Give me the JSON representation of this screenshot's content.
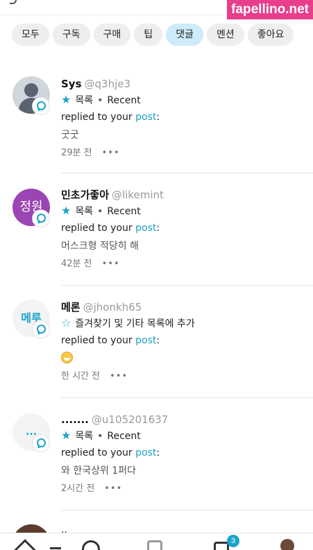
{
  "watermark": "fapellino.net",
  "chips": [
    "모두",
    "구독",
    "구매",
    "팁",
    "댓글",
    "멘션",
    "좋아요"
  ],
  "active_chip": "댓글",
  "notifications": [
    {
      "name": "Sys",
      "handle": "@q3hje3",
      "list": "목록",
      "dot": "•",
      "tag": "Recent",
      "action_text": "replied to your",
      "action_link": "post",
      "action_end": ":",
      "comment": "굿굿",
      "time": "29분 전",
      "more": "•••",
      "avatar_type": "default-avatar"
    },
    {
      "name": "민초가좋아",
      "handle": "@likemint",
      "list": "목록",
      "dot": "•",
      "tag": "Recent",
      "action_text": "replied to your",
      "action_link": "post",
      "action_end": ":",
      "comment": "머스크형 적당히 해",
      "time": "42분 전",
      "more": "•••",
      "avatar_text": "정원"
    },
    {
      "name": "메론",
      "handle": "@jhonkh65",
      "list": "즐겨찾기 및 기타 목록에 추가",
      "action_text": "replied to your",
      "action_link": "post",
      "action_end": ":",
      "comment_emoji": "grinning-emoji",
      "time": "한 시간 전",
      "more": "•••",
      "avatar_text": "메루"
    },
    {
      "name": ".......",
      "handle": "@u105201637",
      "list": "목록",
      "dot": "•",
      "tag": "Recent",
      "action_text": "replied to your",
      "action_link": "post",
      "action_end": ":",
      "comment": "와 한국상위 1퍼다",
      "time": "2시간 전",
      "more": "•••",
      "avatar_text": "..."
    }
  ],
  "partial_next": "..",
  "nav": {
    "notification_count": "3"
  },
  "colors": {
    "accent": "#1aa3c8",
    "active_chip_bg": "#cdebfa"
  }
}
